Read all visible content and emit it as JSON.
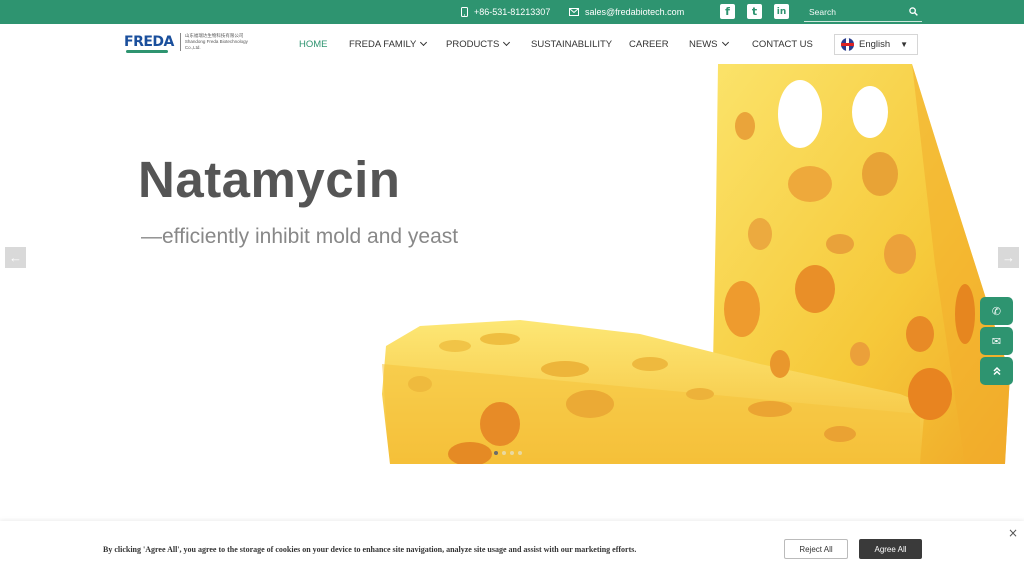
{
  "topbar": {
    "phone": "+86-531-81213307",
    "email": "sales@fredabiotech.com",
    "social": {
      "facebook": "f",
      "twitter": "t",
      "linkedin": "in"
    },
    "search_placeholder": "Search"
  },
  "logo": {
    "brand": "FREDA",
    "cn_name": "山东福瑞达生物科技有限公司",
    "en_name": "Shandong Freda Biotechnology Co.,Ltd."
  },
  "nav": {
    "items": [
      {
        "label": "HOME"
      },
      {
        "label": "FREDA FAMILY"
      },
      {
        "label": "PRODUCTS"
      },
      {
        "label": "SUSTAINABLILITY"
      },
      {
        "label": "CAREER"
      },
      {
        "label": "NEWS"
      },
      {
        "label": "CONTACT US"
      }
    ],
    "language": "English"
  },
  "hero": {
    "title": "Natamycin",
    "subtitle": "—efficiently inhibit mold and yeast",
    "prev_arrow": "←",
    "next_arrow": "→",
    "slide_count": 4,
    "active_slide": 1
  },
  "floating": {
    "phone_icon": "✆",
    "mail_icon": "✉",
    "top_icon": "⌃"
  },
  "cookie": {
    "text": "By clicking 'Agree All', you agree to the storage of cookies on your device to enhance site navigation, analyze site usage and assist with our marketing efforts.",
    "reject_label": "Reject All",
    "agree_label": "Agree All",
    "close": "×"
  },
  "colors": {
    "brand_green": "#2e9470",
    "logo_blue": "#1a4f9c",
    "cheese_yellow": "#f7d34a"
  }
}
